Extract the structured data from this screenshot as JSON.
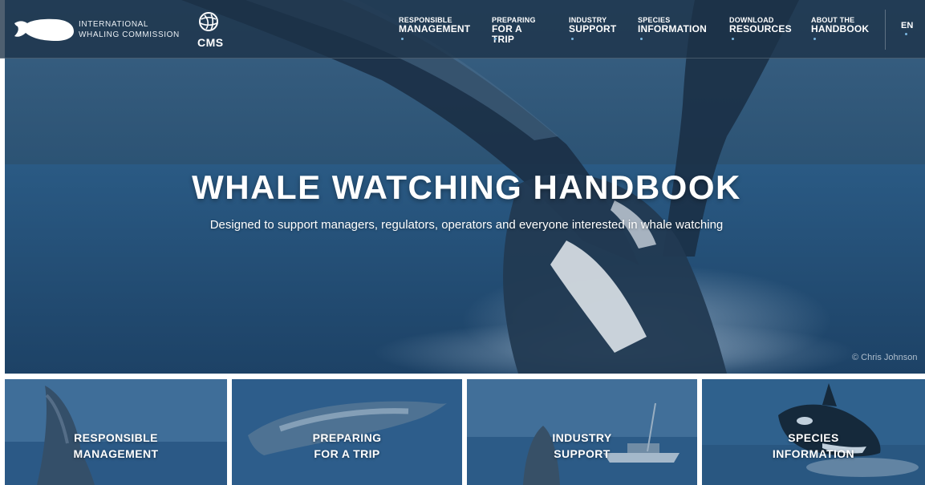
{
  "header": {
    "org_line1": "INTERNATIONAL",
    "org_line2": "WHALING COMMISSION",
    "partner_logo": "CMS",
    "nav": [
      {
        "line1": "RESPONSIBLE",
        "line2": "MANAGEMENT"
      },
      {
        "line1": "PREPARING",
        "line2": "FOR A TRIP"
      },
      {
        "line1": "INDUSTRY",
        "line2": "SUPPORT"
      },
      {
        "line1": "SPECIES",
        "line2": "INFORMATION"
      },
      {
        "line1": "DOWNLOAD",
        "line2": "RESOURCES"
      },
      {
        "line1": "ABOUT THE",
        "line2": "HANDBOOK"
      }
    ],
    "language": "EN"
  },
  "hero": {
    "title": "WHALE WATCHING HANDBOOK",
    "subtitle": "Designed to support managers, regulators, operators and everyone interested in whale watching",
    "photo_credit": "© Chris Johnson"
  },
  "tiles": [
    {
      "line1": "RESPONSIBLE",
      "line2": "MANAGEMENT"
    },
    {
      "line1": "PREPARING",
      "line2": "FOR A TRIP"
    },
    {
      "line1": "INDUSTRY",
      "line2": "SUPPORT"
    },
    {
      "line1": "SPECIES",
      "line2": "INFORMATION"
    }
  ],
  "icons": {
    "iwc_logo": "whale-logo-icon",
    "cms_logo": "cms-globe-icon"
  },
  "colors": {
    "header_bg": "#1c3248",
    "hero_bg": "#2a4e70",
    "tile_overlay": "#2a5a86",
    "nav_dot": "#7ab6e0"
  }
}
